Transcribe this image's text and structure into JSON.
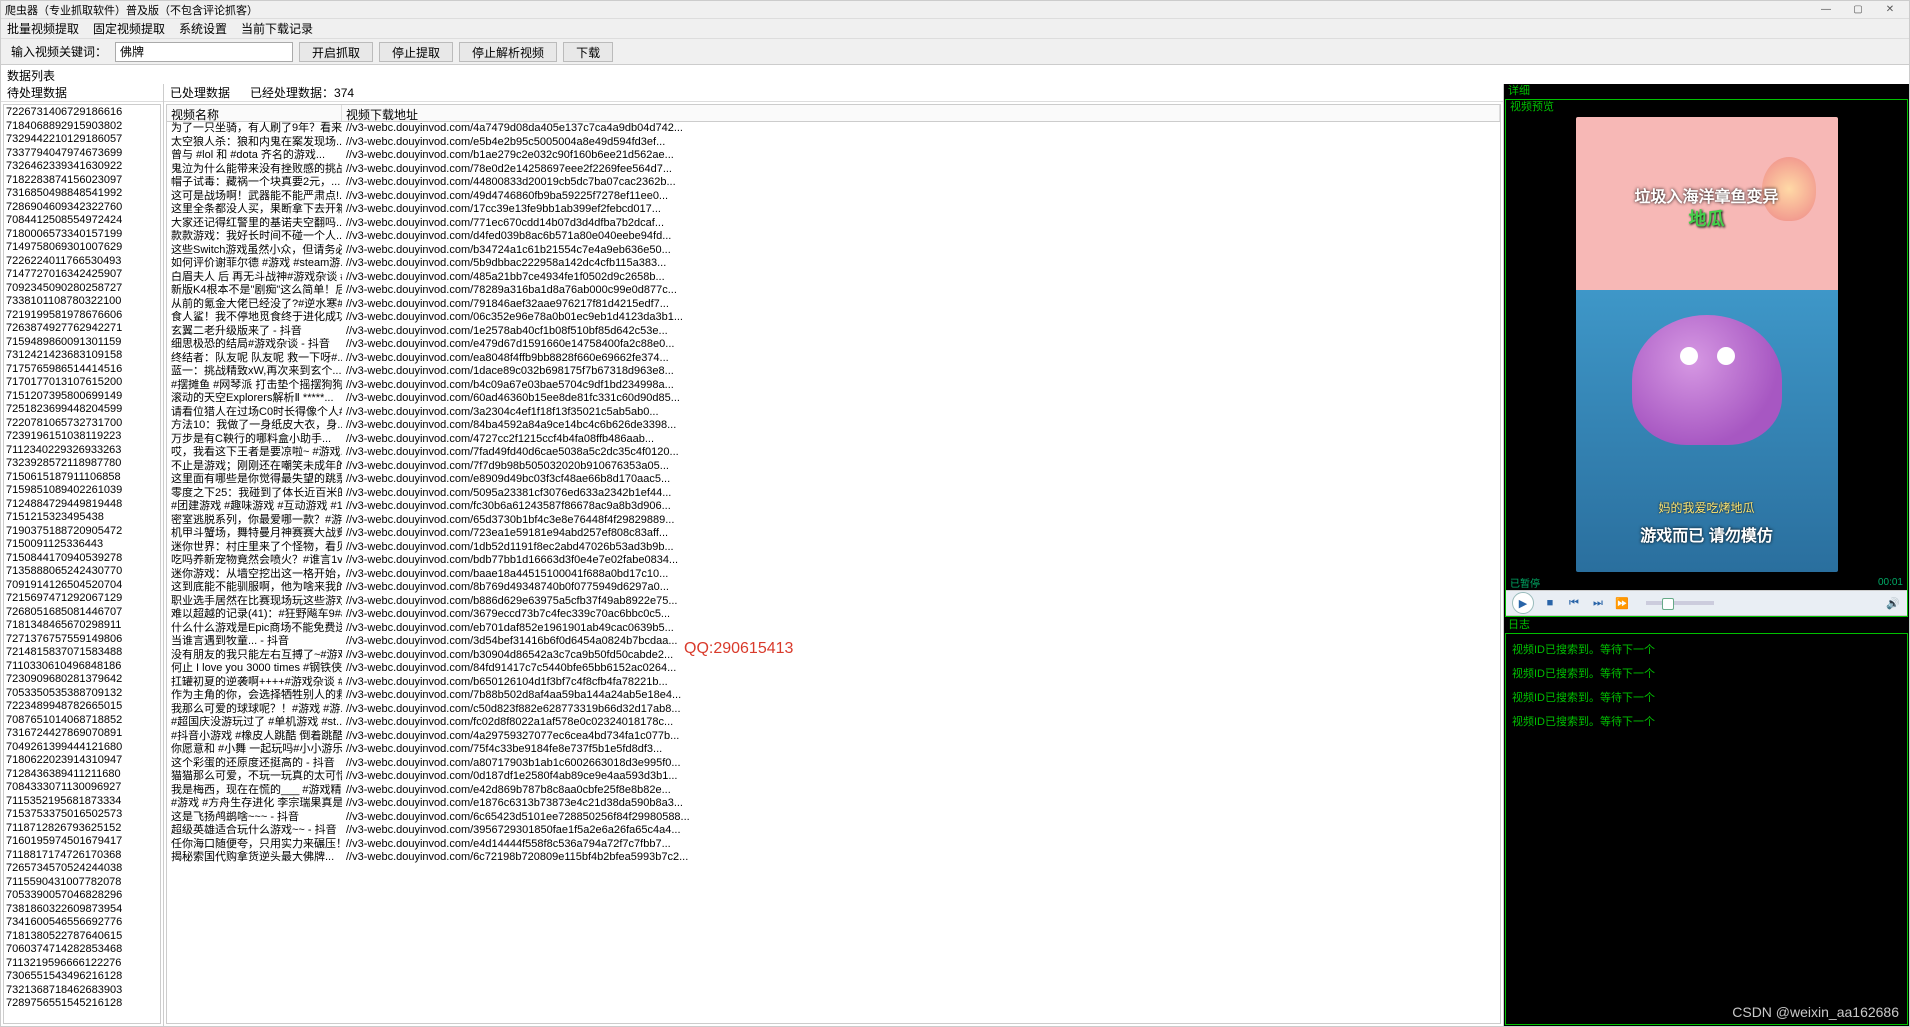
{
  "window": {
    "title": "爬虫器（专业抓取软件）普及版（不包含评论抓客）",
    "min": "—",
    "max": "▢",
    "close": "✕"
  },
  "menu": {
    "m1": "批量视频提取",
    "m2": "固定视频提取",
    "m3": "系统设置",
    "m4": "当前下载记录"
  },
  "toolbar": {
    "label": "输入视频关键词：",
    "keyword": "佛牌",
    "start": "开启抓取",
    "stop": "停止提取",
    "stopParse": "停止解析视频",
    "download": "下载"
  },
  "leftPanel": {
    "title": "数据列表",
    "sub": "待处理数据"
  },
  "midPanel": {
    "processed": "已处理数据",
    "countLabel": "已经处理数据：",
    "count": "374",
    "colName": "视频名称",
    "colUrl": "视频下载地址"
  },
  "ids": [
    "7226731406729186616",
    "7184068892915903802",
    "7329442210129186057",
    "7337794047974673699",
    "7326462339341630922",
    "7182283874156023097",
    "7316850498848541992",
    "7286904609342322760",
    "7084412508554972424",
    "7180006573340157199",
    "7149758069301007629",
    "7226224011766530493",
    "7147727016342425907",
    "7092345090280258727",
    "7338101108780322100",
    "7219199581978676606",
    "7263874927762942271",
    "7159489860091301159",
    "7312421423683109158",
    "7175765986514414516",
    "7170177013107615200",
    "7151207395800699149",
    "7251823699448204599",
    "7220781065732731700",
    "7239196151038119223",
    "7112340229326933263",
    "7323928572118987780",
    "7150615187911106858",
    "7159851089402261039",
    "7124884729449819448",
    "7151215323495438",
    "7190375188720905472",
    "7150091125336443",
    "7150844170940539278",
    "7135888065242430770",
    "7091914126504520704",
    "7215697471292067129",
    "7268051685081446707",
    "7181348465670298911",
    "7271376757559149806",
    "7214815837071583488",
    "7110330610496848186",
    "7230909680281379642",
    "7053350535388709132",
    "7223489948782665015",
    "7087651014068718852",
    "7316724427869070891",
    "7049261399444121680",
    "7180622023914310947",
    "7128436389411211680",
    "7084333071130096927",
    "7115352195681873334",
    "7153753375016502573",
    "7118712826793625152",
    "7160195974501679417",
    "7118817174726170368",
    "7265734570524244038",
    "7115590431007782078",
    "7053390057046828296",
    "7381860322609873954",
    "7341600546556692776",
    "7181380522787640615",
    "7060374714282853468",
    "7113219596666122276",
    "7306551543496216128",
    "7321368718462683903",
    "7289756551545216128"
  ],
  "rows": [
    {
      "n": "为了一只坐骑，有人刷了9年？看来...",
      "u": "//v3-webc.douyinvod.com/4a7479d08da405e137c7ca4a9db04d742..."
    },
    {
      "n": "太空狼人杀：狼和内鬼在案发现场...",
      "u": "//v3-webc.douyinvod.com/e5b4e2b95c5005004a8e49d594fd3ef..."
    },
    {
      "n": "曾与 #lol 和 #dota 齐名的游戏...",
      "u": "//v3-webc.douyinvod.com/b1ae279c2e032c90f160b6ee21d562ae..."
    },
    {
      "n": "鬼泣为什么能带来没有挫败感的挑战...",
      "u": "//v3-webc.douyinvod.com/78e0d2e14258697eee2f2269fee564d7..."
    },
    {
      "n": "帽子试毒：藏祸一个块真要2元，...",
      "u": "//v3-webc.douyinvod.com/44800833d20019cb5dc7ba07cac2362b..."
    },
    {
      "n": "这可是战场啊！武器能不能严肃点!...",
      "u": "//v3-webc.douyinvod.com/49d4746860fb9ba59225f7278ef11ee0..."
    },
    {
      "n": "这里全条都没人买，果断拿下去开箱...",
      "u": "//v3-webc.douyinvod.com/17cc39e13fe9bb1ab399ef2febcd017..."
    },
    {
      "n": "大家还记得红警里的基诺夫空翻吗...",
      "u": "//v3-webc.douyinvod.com/771ec670cdd14b07d3d4dfba7b2dcaf..."
    },
    {
      "n": "款款游戏：我好长时间不碰一个人...",
      "u": "//v3-webc.douyinvod.com/d4fed039b8ac6b571a80e040eebe94fd..."
    },
    {
      "n": "这些Switch游戏虽然小众，但请务必...",
      "u": "//v3-webc.douyinvod.com/b34724a1c61b21554c7e4a9eb636e50..."
    },
    {
      "n": "如何评价谢菲尔德 #游戏 #steam游...",
      "u": "//v3-webc.douyinvod.com/5b9dbbac222958a142dc4cfb115a383..."
    },
    {
      "n": "白眉夫人 后 再无斗战神#游戏杂谈 #...",
      "u": "//v3-webc.douyinvod.com/485a21bb7ce4934fe1f0502d9c2658b..."
    },
    {
      "n": "新版K4根本不是\"剧痴\"这么简单！后...",
      "u": "//v3-webc.douyinvod.com/78289a316ba1d8a76ab000c99e0d877c..."
    },
    {
      "n": "从前的氪金大佬已经没了?#逆水寒#...",
      "u": "//v3-webc.douyinvod.com/791846aef32aae976217f81d4215edf7..."
    },
    {
      "n": "食人鲨！我不停地觅食终于进化成功...",
      "u": "//v3-webc.douyinvod.com/06c352e96e78a0b01ec9eb1d4123da3b1..."
    },
    {
      "n": "玄翼二老升级版来了 - 抖音",
      "u": "//v3-webc.douyinvod.com/1e2578ab40cf1b08f510bf85d642c53e..."
    },
    {
      "n": "细思极恐的结局#游戏杂谈 - 抖音",
      "u": "//v3-webc.douyinvod.com/e479d67d1591660e14758400fa2c88e0..."
    },
    {
      "n": "终结者：队友呢 队友呢 救一下呀#...",
      "u": "//v3-webc.douyinvod.com/ea8048f4ffb9bb8828f660e69662fe374..."
    },
    {
      "n": "蓝一：挑战精致xW,再次来到玄个...",
      "u": "//v3-webc.douyinvod.com/1dace89c032b698175f7b67318d963e8..."
    },
    {
      "n": "#摆摊鱼 #网琴派 打击垫个摇摆狗狗...",
      "u": "//v3-webc.douyinvod.com/b4c09a67e03bae5704c9df1bd234998a..."
    },
    {
      "n": "滚动的天空Explorers解析Ⅱ *****...",
      "u": "//v3-webc.douyinvod.com/60ad46360b15ee8de81fc331c60d90d85..."
    },
    {
      "n": "请看位猎人在过场C0时长得像个人#...",
      "u": "//v3-webc.douyinvod.com/3a2304c4ef1f18f13f35021c5ab5ab0..."
    },
    {
      "n": "方法10：我做了一身纸皮大衣，身...",
      "u": "//v3-webc.douyinvod.com/84ba4592a84a9ce14bc4c6b626de3398..."
    },
    {
      "n": "万步是有C鞅行的哪料盒小助手...",
      "u": "//v3-webc.douyinvod.com/4727cc2f1215ccf4b4fa08ffb486aab..."
    },
    {
      "n": "哎，我看这下王者是要凉啦~ #游戏...",
      "u": "//v3-webc.douyinvod.com/7fad49fd40d6cae5038a5c2dc35c4f0120..."
    },
    {
      "n": "不止是游戏；刚刚还在嘲笑未成年的...",
      "u": "//v3-webc.douyinvod.com/7f7d9b98b505032020b910676353a05..."
    },
    {
      "n": "这里面有哪些是你觉得最失望的跳票...",
      "u": "//v3-webc.douyinvod.com/e8909d49bc03f3cf48ae66b8d170aac5..."
    },
    {
      "n": "零度之下25：我碰到了体长近百米的...",
      "u": "//v3-webc.douyinvod.com/5095a23381cf3076ed633a2342b1ef44..."
    },
    {
      "n": "#团建游戏 #趣味游戏 #互动游戏 #1...",
      "u": "//v3-webc.douyinvod.com/fc30b6a61243587f86678ac9a8b3d906..."
    },
    {
      "n": "密室逃脱系列，你最爱哪一款？#游...",
      "u": "//v3-webc.douyinvod.com/65d3730b1bf4c3e8e76448f4f29829889..."
    },
    {
      "n": "机甲斗蟹场，舞特曼月神赛赛大战竟...",
      "u": "//v3-webc.douyinvod.com/723ea1e59181e94abd257ef808c83aff..."
    },
    {
      "n": "迷你世界：村庄里来了个怪物，看见...",
      "u": "//v3-webc.douyinvod.com/1db52d1191f8ec2abd47026b53ad3b9b..."
    },
    {
      "n": "吃吗养新宠物竟然会喷火？#谁言1vs4 #...",
      "u": "//v3-webc.douyinvod.com/bdb77bb1d16663d3f0e4e7e02fabe0834..."
    },
    {
      "n": "迷你游戏：从墙空挖出这一格开始，...",
      "u": "//v3-webc.douyinvod.com/baae18a44515100041f688a0bd17c10..."
    },
    {
      "n": "这到底能不能驯服啊，他为啥来我的...",
      "u": "//v3-webc.douyinvod.com/8b769d49348740b0f0775949d6297a0..."
    },
    {
      "n": "职业选手居然在比赛现场玩这些游戏...",
      "u": "//v3-webc.douyinvod.com/b886d629e63975a5cfb37f49ab8922e75..."
    },
    {
      "n": "难以超越的记录(41)：#狂野飚车9#a...",
      "u": "//v3-webc.douyinvod.com/3679eccd73b7c4fec339c70ac6bbc0c5..."
    },
    {
      "n": "什么什么游戏是Epic商场不能免费送...",
      "u": "//v3-webc.douyinvod.com/eb701daf852e1961901ab49cac0639b5..."
    },
    {
      "n": "当谁言遇到牧童... - 抖音",
      "u": "//v3-webc.douyinvod.com/3d54bef31416b6f0d6454a0824b7bcdaa..."
    },
    {
      "n": "没有朋友的我只能左右互搏了~#游戏...",
      "u": "//v3-webc.douyinvod.com/b30904d86542a3c7ca9b50fd50cabde2..."
    },
    {
      "n": "何止 I love you 3000 times #钢铁侠 #...",
      "u": "//v3-webc.douyinvod.com/84fd91417c7c5440bfe65bb6152ac0264..."
    },
    {
      "n": "扛罐初夏的逆袭啊++++#游戏杂谈 #8...",
      "u": "//v3-webc.douyinvod.com/b650126104d1f3bf7c4f8cfb4fa78221b..."
    },
    {
      "n": "作为主角的你，会选择牺牲别人的救...",
      "u": "//v3-webc.douyinvod.com/7b88b502d8af4aa59ba144a24ab5e18e4..."
    },
    {
      "n": "我那么可爱的球球呢？！#游戏 #游...",
      "u": "//v3-webc.douyinvod.com/c50d823f882e628773319b66d32d17ab8..."
    },
    {
      "n": "#超国庆没游玩过了 #单机游戏 #st...",
      "u": "//v3-webc.douyinvod.com/fc02d8f8022a1af578e0c02324018178c..."
    },
    {
      "n": "#抖音小游戏 #橡皮人跳酷 倒着跳酷...",
      "u": "//v3-webc.douyinvod.com/4a29759327077ec6cea4bd734fa1c077b..."
    },
    {
      "n": "你愿意和 #小舞 一起玩吗#小小游乐...",
      "u": "//v3-webc.douyinvod.com/75f4c33be9184fe8e737f5b1e5fd8df3..."
    },
    {
      "n": "这个彩蛋的还原度还挺高的 - 抖音",
      "u": "//v3-webc.douyinvod.com/a80717903b1ab1c6002663018d3e995f0..."
    },
    {
      "n": "猫猫那么可爱，不玩一玩真的太可惜...",
      "u": "//v3-webc.douyinvod.com/0d187df1e2580f4ab89ce9e4aa593d3b1..."
    },
    {
      "n": "我是梅西，现在在慌的___ #游戏精...",
      "u": "//v3-webc.douyinvod.com/e42d869b787b8c8aa0cbfe25f8e8b82e..."
    },
    {
      "n": "#游戏 #方舟生存进化 李宗瑞果真是...",
      "u": "//v3-webc.douyinvod.com/e1876c6313b73873e4c21d38da590b8a3..."
    },
    {
      "n": "这是飞扬鸬鹚啥~~~ - 抖音",
      "u": "//v3-webc.douyinvod.com/6c65423d5101ee728850256f84f29980588..."
    },
    {
      "n": "超级英雄适合玩什么游戏~~ - 抖音",
      "u": "//v3-webc.douyinvod.com/3956729301850fae1f5a2e6a26fa65c4a4..."
    },
    {
      "n": "任你海口随便夸，只用实力来碾压！...",
      "u": "//v3-webc.douyinvod.com/e4d14444f558f8c536a794a72f7c7fbb7..."
    },
    {
      "n": "揭秘索国代购拿货逆头最大佛牌...",
      "u": "//v3-webc.douyinvod.com/6c72198b720809e115bf4b2bfea5993b7c2..."
    }
  ],
  "right": {
    "detail": "详细",
    "previewTitle": "视频预览",
    "imgTop": "垃圾入海洋章鱼变异",
    "imgSub": "地瓜",
    "imgBot1": "妈的我爱吃烤地瓜",
    "imgBot2": "游戏而已 请勿模仿",
    "paused": "已暂停",
    "time": "00:01",
    "logTitle": "日志",
    "logs": [
      "视频ID已搜索到。等待下一个",
      "视频ID已搜索到。等待下一个",
      "视频ID已搜索到。等待下一个",
      "视频ID已搜索到。等待下一个"
    ]
  },
  "qq": "QQ:290615413",
  "csdn": "CSDN @weixin_aa162686"
}
